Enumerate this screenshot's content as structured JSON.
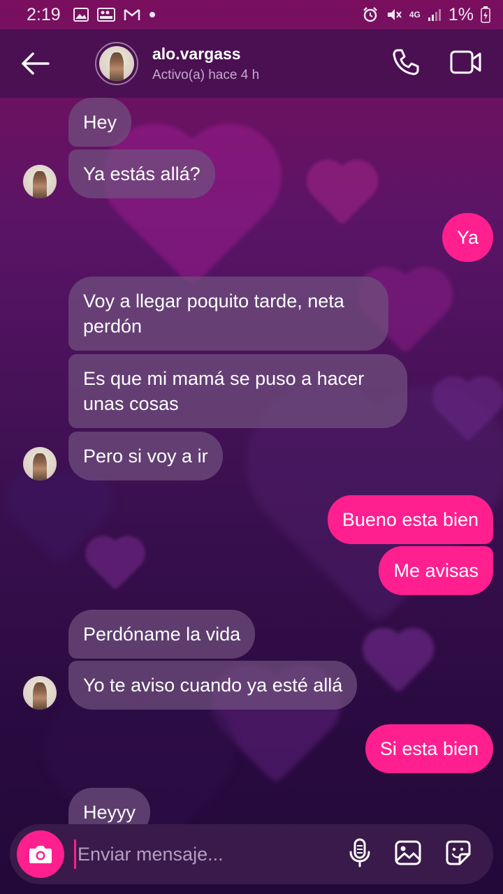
{
  "status_bar": {
    "time": "2:19",
    "network": "4G",
    "battery": "1%",
    "icons_left": [
      "image-icon",
      "gallery-icon",
      "gmail-icon",
      "dot-icon"
    ],
    "icons_right": [
      "alarm-icon",
      "mute-icon",
      "signal-icon",
      "battery-icon"
    ]
  },
  "header": {
    "username": "alo.vargass",
    "status": "Activo(a) hace 4 h",
    "actions": [
      "phone-icon",
      "video-icon"
    ]
  },
  "messages": [
    {
      "side": "in",
      "text": "Hey"
    },
    {
      "side": "in",
      "text": "Ya estás allá?"
    },
    {
      "side": "out",
      "text": "Ya"
    },
    {
      "side": "in",
      "text": "Voy a llegar poquito tarde, neta perdón"
    },
    {
      "side": "in",
      "text": "Es que mi mamá se puso a hacer unas cosas"
    },
    {
      "side": "in",
      "text": "Pero si voy a ir"
    },
    {
      "side": "out",
      "text": "Bueno esta bien"
    },
    {
      "side": "out",
      "text": "Me avisas"
    },
    {
      "side": "in",
      "text": "Perdóname la vida"
    },
    {
      "side": "in",
      "text": "Yo te aviso cuando ya esté allá"
    },
    {
      "side": "out",
      "text": "Si esta bien"
    },
    {
      "side": "in",
      "text": "Heyyy"
    }
  ],
  "composer": {
    "placeholder": "Enviar mensaje...",
    "icons": [
      "camera-icon",
      "microphone-icon",
      "gallery-icon",
      "sticker-icon"
    ]
  },
  "colors": {
    "accent": "#ff1f8e",
    "header_bg": "#4a1052",
    "incoming_bubble": "#70507e"
  }
}
